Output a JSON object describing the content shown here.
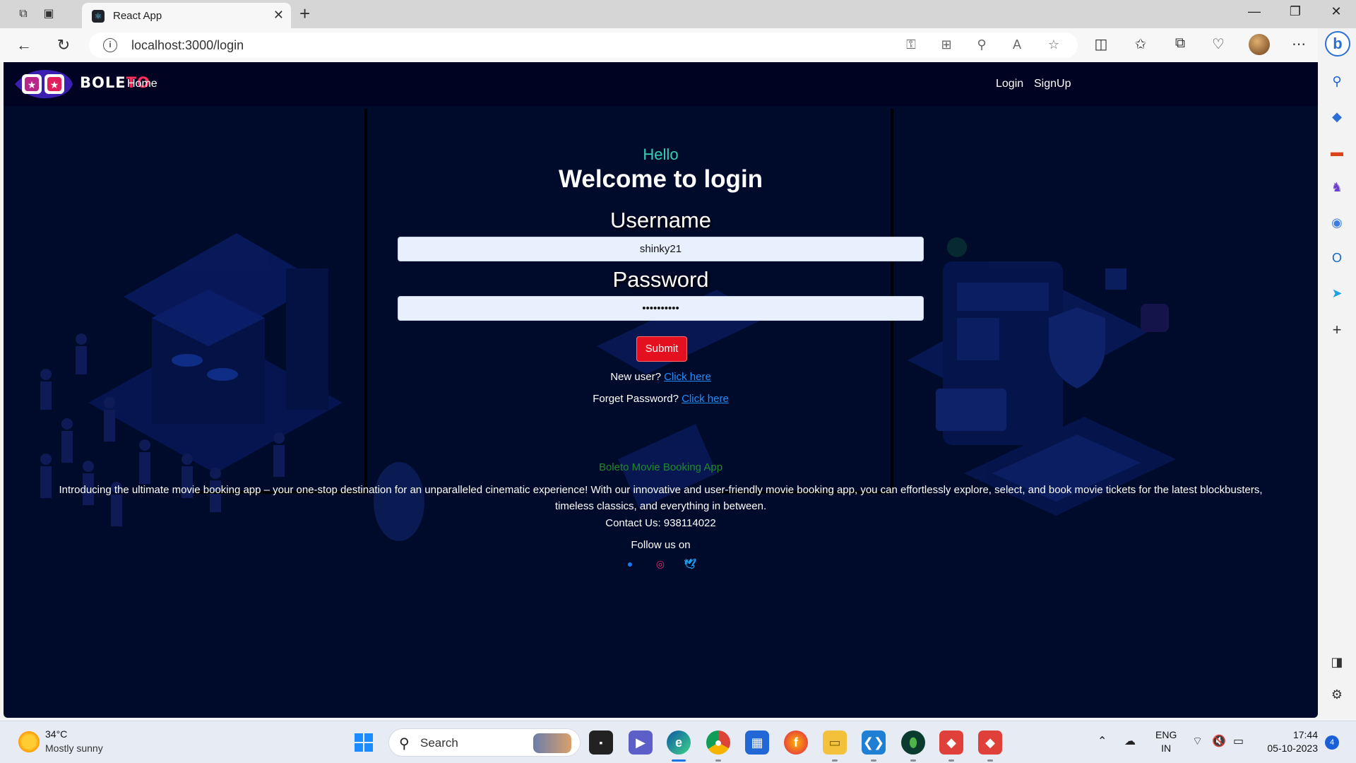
{
  "browser": {
    "tab_title": "React App",
    "url": "localhost:3000/login"
  },
  "site": {
    "brand_main": "BOLE",
    "brand_accent": "TO",
    "nav_home": "Home",
    "nav_login": "Login",
    "nav_signup": "SignUp"
  },
  "login": {
    "hello": "Hello",
    "welcome": "Welcome to login",
    "username_label": "Username",
    "username_value": "shinky21",
    "password_label": "Password",
    "password_value": "••••••••••",
    "submit_label": "Submit",
    "new_user_text": "New user? ",
    "new_user_link": "Click here",
    "forget_text": "Forget Password? ",
    "forget_link": "Click here"
  },
  "footer": {
    "title": "Boleto Movie Booking App",
    "description": "Introducing the ultimate movie booking app – your one-stop destination for an unparalleled cinematic experience! With our innovative and user-friendly movie booking app, you can effortlessly explore, select, and book movie tickets for the latest blockbusters, timeless classics, and everything in between.",
    "contact": "Contact Us: 938114022",
    "follow": "Follow us on",
    "social_icons": [
      "facebook-icon",
      "instagram-icon",
      "twitter-icon"
    ]
  },
  "taskbar": {
    "temperature": "34°C",
    "weather": "Mostly sunny",
    "search_placeholder": "Search",
    "lang_1": "ENG",
    "lang_2": "IN",
    "time": "17:44",
    "date": "05-10-2023",
    "notification_count": "4"
  },
  "colors": {
    "page_bg": "#000a2b",
    "nav_bg": "#000322",
    "hello": "#31d2b4",
    "submit": "#e4101f",
    "link": "#1e90ff",
    "footer_title": "#1f8a2a",
    "brand_accent": "#ff2e5c"
  }
}
